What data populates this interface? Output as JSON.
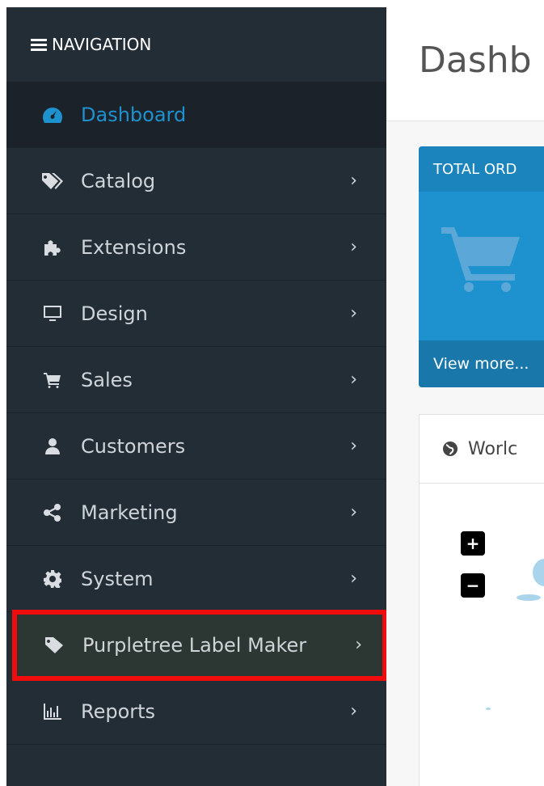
{
  "sidebar": {
    "header": "NAVIGATION",
    "items": [
      {
        "label": "Dashboard",
        "icon": "dashboard-icon",
        "active": true,
        "chevron": ""
      },
      {
        "label": "Catalog",
        "icon": "tags-icon",
        "chevron": "›"
      },
      {
        "label": "Extensions",
        "icon": "puzzle-icon",
        "chevron": "›"
      },
      {
        "label": "Design",
        "icon": "monitor-icon",
        "chevron": "›"
      },
      {
        "label": "Sales",
        "icon": "cart-icon",
        "chevron": "›"
      },
      {
        "label": "Customers",
        "icon": "user-icon",
        "chevron": "›"
      },
      {
        "label": "Marketing",
        "icon": "share-icon",
        "chevron": "›"
      },
      {
        "label": "System",
        "icon": "gear-icon",
        "chevron": "›"
      },
      {
        "label": "Purpletree Label Maker",
        "icon": "tag-icon",
        "chevron": "›",
        "highlighted": true
      },
      {
        "label": "Reports",
        "icon": "bar-chart-icon",
        "chevron": "›"
      }
    ]
  },
  "main": {
    "title": "Dashb",
    "tile": {
      "header": "TOTAL ORD",
      "footer": "View more..."
    },
    "map_panel": {
      "title": "Worlc",
      "zoom_in": "+",
      "zoom_out": "−"
    }
  },
  "colors": {
    "sidebar_bg": "#232d36",
    "active": "#1e91cf",
    "highlight": "#f00d0d",
    "tile": "#1e91cf"
  }
}
